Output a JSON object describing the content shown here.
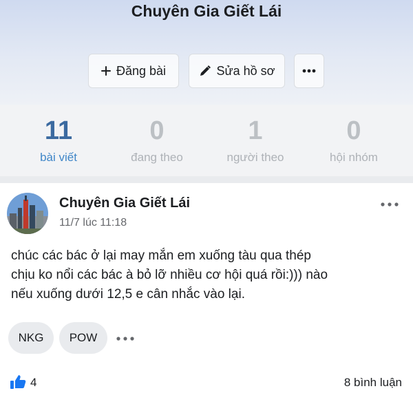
{
  "profile": {
    "name": "Chuyên Gia Giết Lái"
  },
  "actions": {
    "post_label": "Đăng bài",
    "edit_label": "Sửa hồ sơ",
    "more_icon": "more-horizontal-icon"
  },
  "stats": [
    {
      "value": "11",
      "label": "bài viết",
      "active": true
    },
    {
      "value": "0",
      "label": "đang theo",
      "active": false
    },
    {
      "value": "1",
      "label": "người theo",
      "active": false
    },
    {
      "value": "0",
      "label": "hội nhóm",
      "active": false
    }
  ],
  "post": {
    "author": "Chuyên Gia Giết Lái",
    "timestamp": "11/7 lúc 11:18",
    "text_lines": [
      "chúc các bác ở lại may mắn em xuống tàu qua thép",
      "chịu ko nổi các bác à bỏ lỡ nhiều cơ hội quá rồi:))) nào",
      "nếu xuống dưới 12,5 e cân nhắc vào lại."
    ],
    "tags": [
      "NKG",
      "POW"
    ],
    "likes": "4",
    "comments": "8 bình luận"
  },
  "colors": {
    "accent": "#3f86c8",
    "like_blue": "#1877f2",
    "muted_text": "#65676b"
  }
}
